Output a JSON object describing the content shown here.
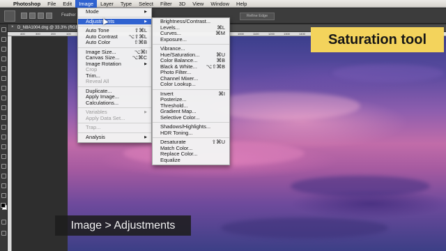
{
  "menubar": {
    "apple": "",
    "items": [
      "Photoshop",
      "File",
      "Edit",
      "Image",
      "Layer",
      "Type",
      "Select",
      "Filter",
      "3D",
      "View",
      "Window",
      "Help"
    ],
    "active": "Image"
  },
  "options_bar": {
    "feather_label": "Feather",
    "refine_label": "Refine Edge"
  },
  "document": {
    "tab_title": "D_N8A1004.dng @ 33.3% (RGB/8*)",
    "ruler_ticks": [
      "400",
      "300",
      "200",
      "100",
      "0",
      "100",
      "200",
      "300",
      "400",
      "500",
      "600",
      "700",
      "800",
      "900",
      "1000",
      "1100",
      "1200",
      "1300",
      "1400",
      "1500",
      "1600",
      "1700",
      "1800",
      "1900",
      "2000",
      "2100",
      "2200",
      "2300",
      "2400"
    ]
  },
  "image_menu": {
    "mode": "Mode",
    "adjustments": "Adjustments",
    "auto_tone": "Auto Tone",
    "auto_tone_sc": "⇧⌘L",
    "auto_contrast": "Auto Contrast",
    "auto_contrast_sc": "⌥⇧⌘L",
    "auto_color": "Auto Color",
    "auto_color_sc": "⇧⌘B",
    "image_size": "Image Size...",
    "image_size_sc": "⌥⌘I",
    "canvas_size": "Canvas Size...",
    "canvas_size_sc": "⌥⌘C",
    "image_rotation": "Image Rotation",
    "crop": "Crop",
    "trim": "Trim...",
    "reveal_all": "Reveal All",
    "duplicate": "Duplicate...",
    "apply_image": "Apply Image...",
    "calculations": "Calculations...",
    "variables": "Variables",
    "apply_data_set": "Apply Data Set...",
    "trap": "Trap...",
    "analysis": "Analysis"
  },
  "adjustments_menu": {
    "brightness": "Brightness/Contrast...",
    "levels": "Levels...",
    "levels_sc": "⌘L",
    "curves": "Curves...",
    "curves_sc": "⌘M",
    "exposure": "Exposure...",
    "vibrance": "Vibrance...",
    "hue_sat": "Hue/Saturation...",
    "hue_sat_sc": "⌘U",
    "color_balance": "Color Balance...",
    "color_balance_sc": "⌘B",
    "bw": "Black & White...",
    "bw_sc": "⌥⇧⌘B",
    "photo_filter": "Photo Filter...",
    "channel_mixer": "Channel Mixer...",
    "color_lookup": "Color Lookup...",
    "invert": "Invert",
    "invert_sc": "⌘I",
    "posterize": "Posterize...",
    "threshold": "Threshold...",
    "gradient_map": "Gradient Map...",
    "selective_color": "Selective Color...",
    "shadows": "Shadows/Highlights...",
    "hdr": "HDR Toning...",
    "desaturate": "Desaturate",
    "desaturate_sc": "⇧⌘U",
    "match_color": "Match Color...",
    "replace_color": "Replace Color...",
    "equalize": "Equalize"
  },
  "overlay": {
    "callout": "Saturation tool",
    "caption": "Image > Adjustments"
  },
  "colors": {
    "highlight": "#2f62d0",
    "callout_bg": "#f3d35c"
  }
}
